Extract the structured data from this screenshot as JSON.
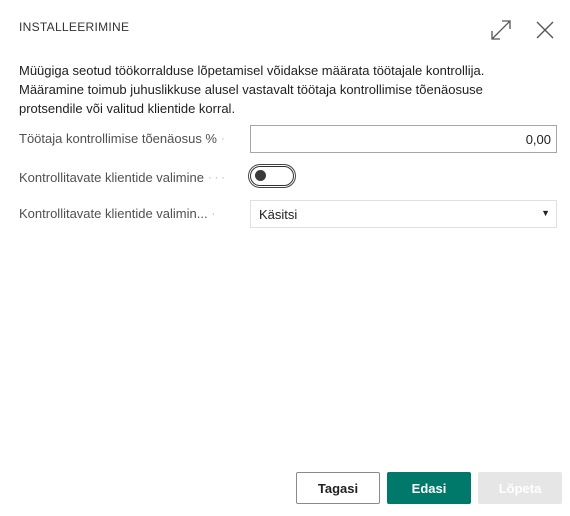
{
  "dialog": {
    "title": "INSTALLEERIMINE",
    "expand_icon": "expand-icon",
    "close_icon": "close-icon"
  },
  "intro": {
    "text": "Müügiga seotud töökorralduse lõpetamisel võidakse määrata töötajale kontrollija. Määramine toimub juhuslikkuse alusel vastavalt töötaja kontrollimise tõenäosuse protsendile või valitud klientide korral."
  },
  "fields": {
    "probability": {
      "label": "Töötaja kontrollimise tõenäosus %",
      "value": "0,00"
    },
    "client_selection": {
      "label": "Kontrollitavate klientide valimine",
      "toggle_state": "off"
    },
    "client_selection_method": {
      "label": "Kontrollitavate klientide valimin...",
      "value": "Käsitsi"
    }
  },
  "buttons": {
    "back": "Tagasi",
    "next": "Edasi",
    "finish": "Lõpeta"
  },
  "colors": {
    "primary": "#00796b",
    "disabled": "#e6e6e6"
  }
}
